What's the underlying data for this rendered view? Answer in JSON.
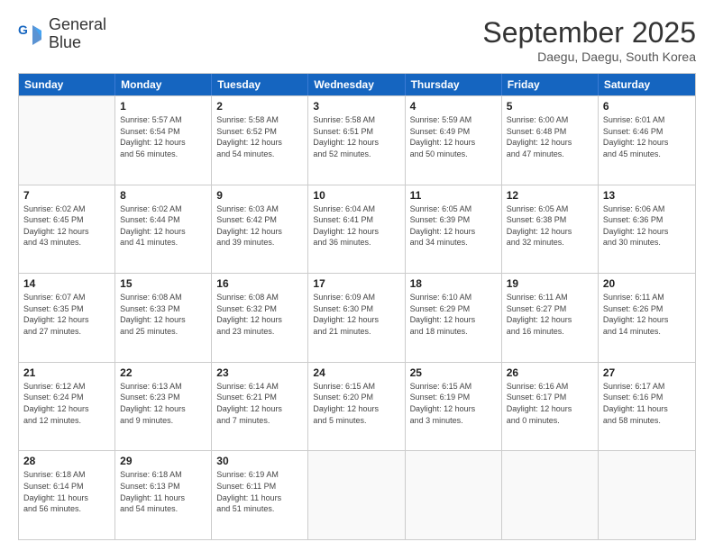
{
  "header": {
    "logo_line1": "General",
    "logo_line2": "Blue",
    "month_title": "September 2025",
    "location": "Daegu, Daegu, South Korea"
  },
  "days_of_week": [
    "Sunday",
    "Monday",
    "Tuesday",
    "Wednesday",
    "Thursday",
    "Friday",
    "Saturday"
  ],
  "weeks": [
    [
      {
        "day": "",
        "info": ""
      },
      {
        "day": "1",
        "info": "Sunrise: 5:57 AM\nSunset: 6:54 PM\nDaylight: 12 hours\nand 56 minutes."
      },
      {
        "day": "2",
        "info": "Sunrise: 5:58 AM\nSunset: 6:52 PM\nDaylight: 12 hours\nand 54 minutes."
      },
      {
        "day": "3",
        "info": "Sunrise: 5:58 AM\nSunset: 6:51 PM\nDaylight: 12 hours\nand 52 minutes."
      },
      {
        "day": "4",
        "info": "Sunrise: 5:59 AM\nSunset: 6:49 PM\nDaylight: 12 hours\nand 50 minutes."
      },
      {
        "day": "5",
        "info": "Sunrise: 6:00 AM\nSunset: 6:48 PM\nDaylight: 12 hours\nand 47 minutes."
      },
      {
        "day": "6",
        "info": "Sunrise: 6:01 AM\nSunset: 6:46 PM\nDaylight: 12 hours\nand 45 minutes."
      }
    ],
    [
      {
        "day": "7",
        "info": "Sunrise: 6:02 AM\nSunset: 6:45 PM\nDaylight: 12 hours\nand 43 minutes."
      },
      {
        "day": "8",
        "info": "Sunrise: 6:02 AM\nSunset: 6:44 PM\nDaylight: 12 hours\nand 41 minutes."
      },
      {
        "day": "9",
        "info": "Sunrise: 6:03 AM\nSunset: 6:42 PM\nDaylight: 12 hours\nand 39 minutes."
      },
      {
        "day": "10",
        "info": "Sunrise: 6:04 AM\nSunset: 6:41 PM\nDaylight: 12 hours\nand 36 minutes."
      },
      {
        "day": "11",
        "info": "Sunrise: 6:05 AM\nSunset: 6:39 PM\nDaylight: 12 hours\nand 34 minutes."
      },
      {
        "day": "12",
        "info": "Sunrise: 6:05 AM\nSunset: 6:38 PM\nDaylight: 12 hours\nand 32 minutes."
      },
      {
        "day": "13",
        "info": "Sunrise: 6:06 AM\nSunset: 6:36 PM\nDaylight: 12 hours\nand 30 minutes."
      }
    ],
    [
      {
        "day": "14",
        "info": "Sunrise: 6:07 AM\nSunset: 6:35 PM\nDaylight: 12 hours\nand 27 minutes."
      },
      {
        "day": "15",
        "info": "Sunrise: 6:08 AM\nSunset: 6:33 PM\nDaylight: 12 hours\nand 25 minutes."
      },
      {
        "day": "16",
        "info": "Sunrise: 6:08 AM\nSunset: 6:32 PM\nDaylight: 12 hours\nand 23 minutes."
      },
      {
        "day": "17",
        "info": "Sunrise: 6:09 AM\nSunset: 6:30 PM\nDaylight: 12 hours\nand 21 minutes."
      },
      {
        "day": "18",
        "info": "Sunrise: 6:10 AM\nSunset: 6:29 PM\nDaylight: 12 hours\nand 18 minutes."
      },
      {
        "day": "19",
        "info": "Sunrise: 6:11 AM\nSunset: 6:27 PM\nDaylight: 12 hours\nand 16 minutes."
      },
      {
        "day": "20",
        "info": "Sunrise: 6:11 AM\nSunset: 6:26 PM\nDaylight: 12 hours\nand 14 minutes."
      }
    ],
    [
      {
        "day": "21",
        "info": "Sunrise: 6:12 AM\nSunset: 6:24 PM\nDaylight: 12 hours\nand 12 minutes."
      },
      {
        "day": "22",
        "info": "Sunrise: 6:13 AM\nSunset: 6:23 PM\nDaylight: 12 hours\nand 9 minutes."
      },
      {
        "day": "23",
        "info": "Sunrise: 6:14 AM\nSunset: 6:21 PM\nDaylight: 12 hours\nand 7 minutes."
      },
      {
        "day": "24",
        "info": "Sunrise: 6:15 AM\nSunset: 6:20 PM\nDaylight: 12 hours\nand 5 minutes."
      },
      {
        "day": "25",
        "info": "Sunrise: 6:15 AM\nSunset: 6:19 PM\nDaylight: 12 hours\nand 3 minutes."
      },
      {
        "day": "26",
        "info": "Sunrise: 6:16 AM\nSunset: 6:17 PM\nDaylight: 12 hours\nand 0 minutes."
      },
      {
        "day": "27",
        "info": "Sunrise: 6:17 AM\nSunset: 6:16 PM\nDaylight: 11 hours\nand 58 minutes."
      }
    ],
    [
      {
        "day": "28",
        "info": "Sunrise: 6:18 AM\nSunset: 6:14 PM\nDaylight: 11 hours\nand 56 minutes."
      },
      {
        "day": "29",
        "info": "Sunrise: 6:18 AM\nSunset: 6:13 PM\nDaylight: 11 hours\nand 54 minutes."
      },
      {
        "day": "30",
        "info": "Sunrise: 6:19 AM\nSunset: 6:11 PM\nDaylight: 11 hours\nand 51 minutes."
      },
      {
        "day": "",
        "info": ""
      },
      {
        "day": "",
        "info": ""
      },
      {
        "day": "",
        "info": ""
      },
      {
        "day": "",
        "info": ""
      }
    ]
  ]
}
